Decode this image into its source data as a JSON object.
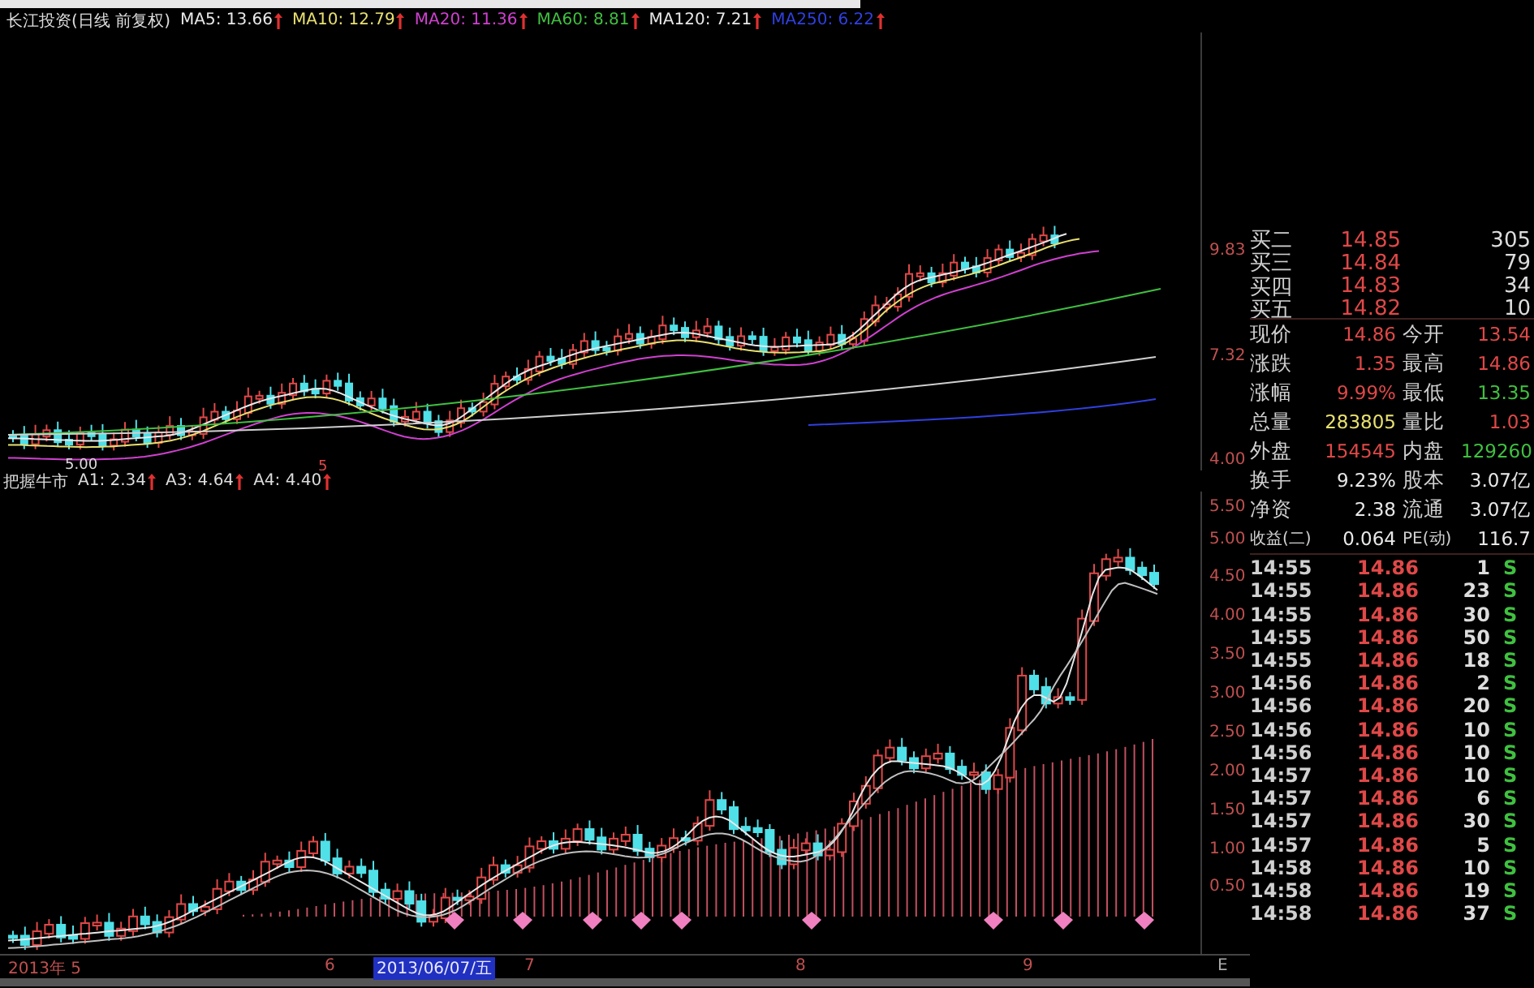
{
  "chart_header": {
    "title": "长江投资(日线 前复权)",
    "moving_averages": [
      {
        "label": "MA5: 13.66",
        "color": "#e8e8e8"
      },
      {
        "label": "MA10: 12.79",
        "color": "#e8e070"
      },
      {
        "label": "MA20: 11.36",
        "color": "#d040d0"
      },
      {
        "label": "MA60: 8.81",
        "color": "#40c040"
      },
      {
        "label": "MA120: 7.21",
        "color": "#e8e8e8"
      },
      {
        "label": "MA250: 6.22",
        "color": "#3040e0"
      }
    ]
  },
  "price_axis_labels": [
    "9.83",
    "7.32",
    "4.00"
  ],
  "low_marker": "5.00",
  "period_marker": "5",
  "indicator_header": {
    "title": "把握牛市",
    "values": [
      "A1: 2.34",
      "A3: 4.64",
      "A4: 4.40"
    ]
  },
  "indicator_axis_labels": [
    "5.50",
    "5.00",
    "4.50",
    "4.00",
    "3.50",
    "3.00",
    "2.50",
    "2.00",
    "1.50",
    "1.00",
    "0.50"
  ],
  "date_axis": [
    {
      "label": "2013年 5",
      "selected": false
    },
    {
      "label": "6",
      "selected": false
    },
    {
      "label": "2013/06/07/五",
      "selected": true
    },
    {
      "label": "7",
      "selected": false
    },
    {
      "label": "8",
      "selected": false
    },
    {
      "label": "9",
      "selected": false
    }
  ],
  "axis_end_mark": "E",
  "quote_panel": {
    "bids": [
      {
        "label": "买二",
        "price": "14.85",
        "volume": "305"
      },
      {
        "label": "买三",
        "price": "14.84",
        "volume": "79"
      },
      {
        "label": "买四",
        "price": "14.83",
        "volume": "34"
      },
      {
        "label": "买五",
        "price": "14.82",
        "volume": "10"
      }
    ],
    "stats": [
      [
        {
          "label": "现价",
          "value": "14.86",
          "color": "#e04848"
        },
        {
          "label": "今开",
          "value": "13.54",
          "color": "#e04848"
        }
      ],
      [
        {
          "label": "涨跌",
          "value": "1.35",
          "color": "#e04848"
        },
        {
          "label": "最高",
          "value": "14.86",
          "color": "#e04848"
        }
      ],
      [
        {
          "label": "涨幅",
          "value": "9.99%",
          "color": "#e04848"
        },
        {
          "label": "最低",
          "value": "13.35",
          "color": "#40c040"
        }
      ],
      [
        {
          "label": "总量",
          "value": "283805",
          "color": "#e8e070"
        },
        {
          "label": "量比",
          "value": "1.03",
          "color": "#e04848"
        }
      ],
      [
        {
          "label": "外盘",
          "value": "154545",
          "color": "#e04848"
        },
        {
          "label": "内盘",
          "value": "129260",
          "color": "#40c040"
        }
      ],
      [
        {
          "label": "换手",
          "value": "9.23%",
          "color": "#e8e8e8"
        },
        {
          "label": "股本",
          "value": "3.07亿",
          "color": "#e8e8e8"
        }
      ],
      [
        {
          "label": "净资",
          "value": "2.38",
          "color": "#e8e8e8"
        },
        {
          "label": "流通",
          "value": "3.07亿",
          "color": "#e8e8e8"
        }
      ],
      [
        {
          "label": "收益(二)",
          "value": "0.064",
          "color": "#e8e8e8"
        },
        {
          "label": "PE(动)",
          "value": "116.7",
          "color": "#e8e8e8"
        }
      ]
    ],
    "trades": [
      {
        "time": "14:55",
        "price": "14.86",
        "volume": "1",
        "side": "S"
      },
      {
        "time": "14:55",
        "price": "14.86",
        "volume": "23",
        "side": "S"
      },
      {
        "time": "14:55",
        "price": "14.86",
        "volume": "30",
        "side": "S"
      },
      {
        "time": "14:55",
        "price": "14.86",
        "volume": "50",
        "side": "S"
      },
      {
        "time": "14:55",
        "price": "14.86",
        "volume": "18",
        "side": "S"
      },
      {
        "time": "14:56",
        "price": "14.86",
        "volume": "2",
        "side": "S"
      },
      {
        "time": "14:56",
        "price": "14.86",
        "volume": "20",
        "side": "S"
      },
      {
        "time": "14:56",
        "price": "14.86",
        "volume": "10",
        "side": "S"
      },
      {
        "time": "14:56",
        "price": "14.86",
        "volume": "10",
        "side": "S"
      },
      {
        "time": "14:57",
        "price": "14.86",
        "volume": "10",
        "side": "S"
      },
      {
        "time": "14:57",
        "price": "14.86",
        "volume": "6",
        "side": "S"
      },
      {
        "time": "14:57",
        "price": "14.86",
        "volume": "30",
        "side": "S"
      },
      {
        "time": "14:57",
        "price": "14.86",
        "volume": "5",
        "side": "S"
      },
      {
        "time": "14:58",
        "price": "14.86",
        "volume": "10",
        "side": "S"
      },
      {
        "time": "14:58",
        "price": "14.86",
        "volume": "19",
        "side": "S"
      },
      {
        "time": "14:58",
        "price": "14.86",
        "volume": "37",
        "side": "S"
      }
    ]
  }
}
